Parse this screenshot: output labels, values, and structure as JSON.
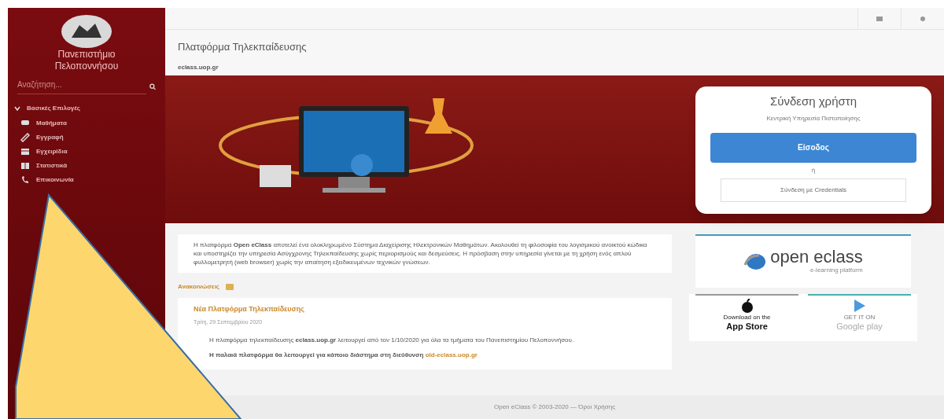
{
  "sidebar": {
    "university": "Πανεπιστήμιο Πελοποννήσου",
    "search": {
      "placeholder": "Αναζήτηση..."
    },
    "menu": {
      "title": "Βασικές Επιλογές",
      "expanded": true,
      "items": [
        {
          "label": "Μαθήματα",
          "kind": "chat"
        },
        {
          "label": "Εγγραφή",
          "kind": "pencil"
        },
        {
          "label": "Εγχειρίδια",
          "kind": "book"
        },
        {
          "label": "Στατιστικά",
          "kind": "table"
        },
        {
          "label": "Επικοινωνία",
          "kind": "phone"
        }
      ]
    }
  },
  "header": {
    "title": "Πλατφόρμα Τηλεκπαίδευσης",
    "breadcrumb": "eclass.uop.gr"
  },
  "login": {
    "title": "Σύνδεση χρήστη",
    "subtitle": "Κεντρική Υπηρεσία Πιστοποίησης",
    "login_button": "Είσοδος",
    "separator": "ή",
    "alt_button": "Σύνδεση με Credentials"
  },
  "intro": "Η πλατφόρμα **Open eClass** αποτελεί ένα ολοκληρωμένο Σύστημα Διαχείρισης Ηλεκτρονικών Μαθημάτων. Ακολουθεί τη φιλοσοφία του λογισμικού ανοικτού κώδικα και υποστηρίζει την υπηρεσία Ασύγχρονης Τηλεκπαίδευσης χωρίς περιορισμούς και δεσμεύσεις. Η πρόσβαση στην υπηρεσία γίνεται με τη χρήση ενός απλού φυλλομετρητή (web browser) χωρίς την απαίτηση εξειδικευμένων τεχνικών γνώσεων.",
  "announcements": {
    "title": "Ανακοινώσεις",
    "items": [
      {
        "title": "Νέα Πλατφόρμα Τηλεκπαίδευσης",
        "date": "Τρίτη, 29 Σεπτεμβρίου 2020",
        "body": "Η πλατφόρμα τηλεκπαίδευσης **eclass.uop.gr** λειτουργεί από τον 1/10/2020 για όλα τα τμήματα του Πανεπιστημίου Πελοποννήσου.",
        "note": "Η παλαιά πλατφόρμα θα λειτουργεί για κάποιο διάστημα στη διεύθυνση",
        "link": "old-eclass.uop.gr"
      }
    ]
  },
  "logo": {
    "name": "open eclass",
    "tagline": "e-learning platform"
  },
  "stores": [
    {
      "kind": "apple",
      "small": "Download on the",
      "big": "App Store"
    },
    {
      "kind": "google",
      "small": "GET IT ON",
      "big": "Google play"
    }
  ],
  "footer": "Open eClass © 2003-2020 — Όροι Χρήσης"
}
